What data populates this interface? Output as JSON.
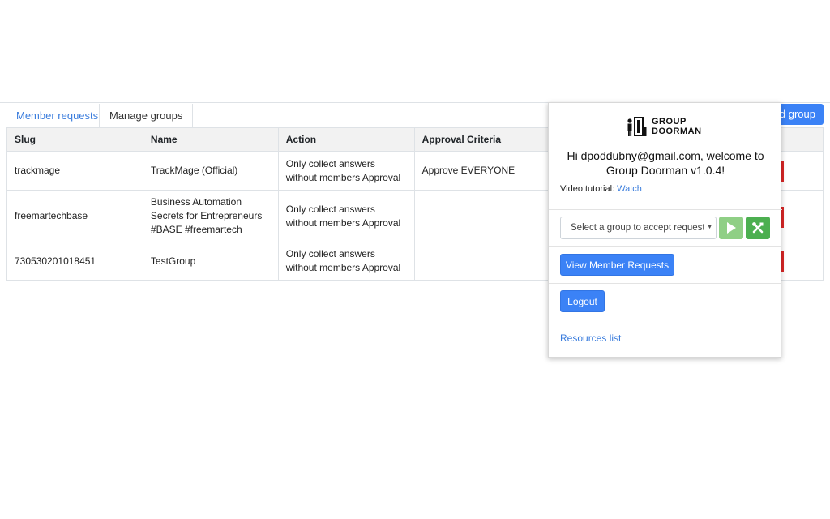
{
  "tabs": [
    {
      "label": "Member requests"
    },
    {
      "label": "Manage groups"
    }
  ],
  "add_group_label": "dd group",
  "table": {
    "headers": [
      "Slug",
      "Name",
      "Action",
      "Approval Criteria"
    ],
    "rows": [
      {
        "slug": "trackmage",
        "name": "TrackMage (Official)",
        "action": "Only collect answers without members Approval",
        "criteria": "Approve EVERYONE"
      },
      {
        "slug": "freemartechbase",
        "name": "Business Automation Secrets for Entrepreneurs #BASE #freemartech",
        "action": "Only collect answers without members Approval",
        "criteria": ""
      },
      {
        "slug": "730530201018451",
        "name": "TestGroup",
        "action": "Only collect answers without members Approval",
        "criteria": ""
      }
    ]
  },
  "popup": {
    "logo_line1": "GROUP",
    "logo_line2": "DOORMAN",
    "welcome_line1": "Hi dpoddubny@gmail.com, welcome to",
    "welcome_line2": "Group Doorman v1.0.4!",
    "tutorial_label": "Video tutorial:",
    "tutorial_link": "Watch",
    "select_placeholder": "Select a group to accept requests",
    "view_requests_label": "View Member Requests",
    "logout_label": "Logout",
    "resources_label": "Resources list"
  },
  "colors": {
    "accent": "#3b82f6",
    "link": "#3b7ddd",
    "play": "#8fcf85",
    "tools": "#4caf50",
    "danger": "#d92626"
  },
  "icons": {
    "logo": "door-person-icon",
    "play": "play-icon",
    "tools": "tools-icon"
  }
}
